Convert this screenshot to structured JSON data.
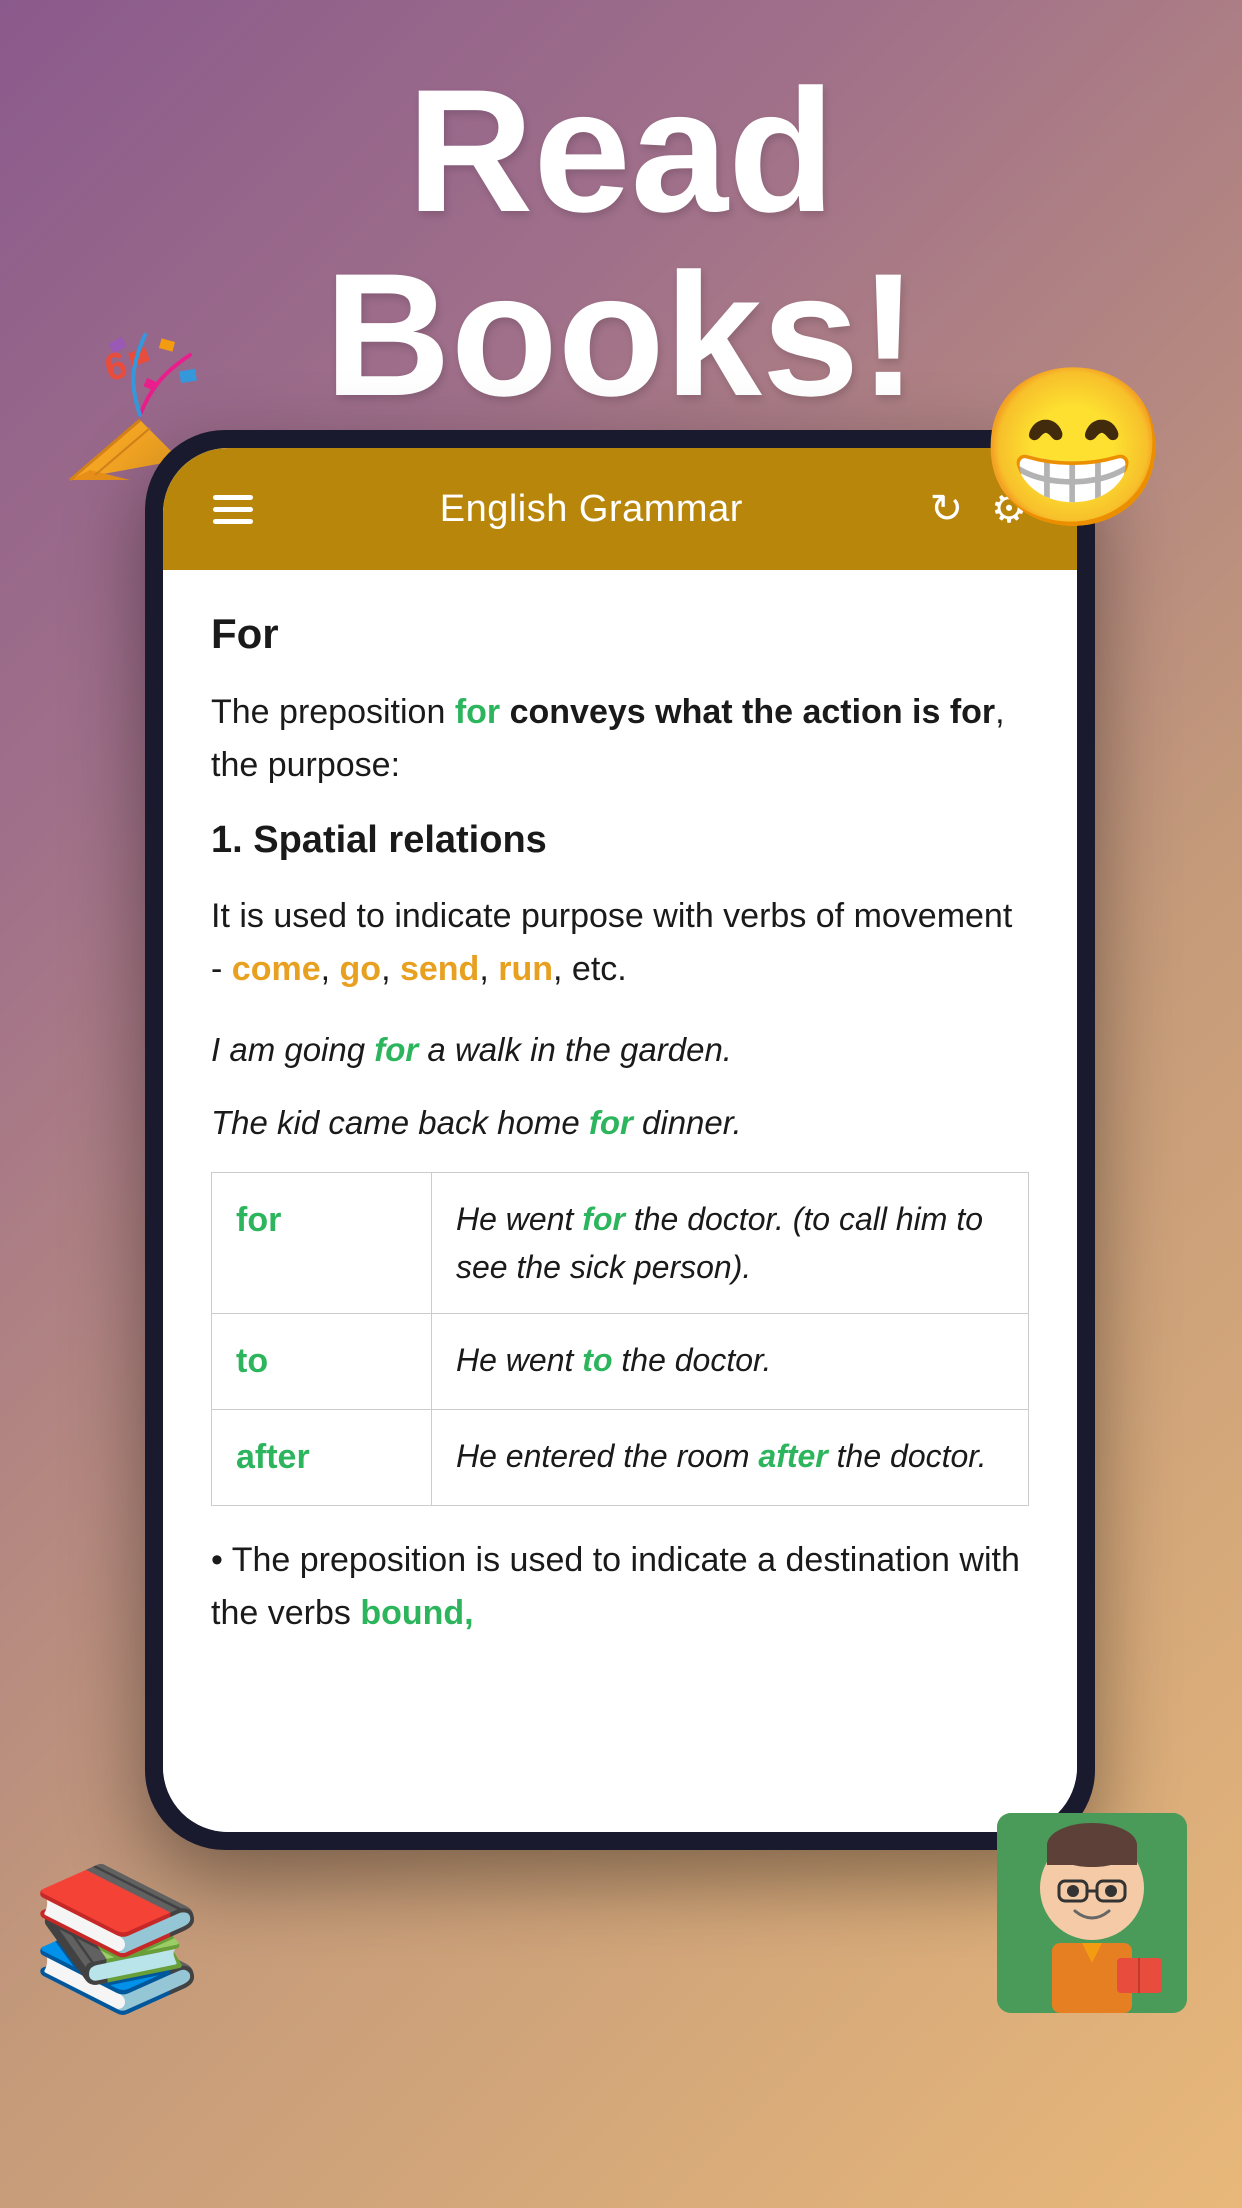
{
  "headline": {
    "line1": "Read",
    "line2": "Books!"
  },
  "decorations": {
    "confetti": "🎉",
    "emoji": "😁",
    "books": "📚",
    "student": "👨‍🏫"
  },
  "app": {
    "header": {
      "title": "English Grammar",
      "menu_label": "menu",
      "refresh_label": "refresh",
      "settings_label": "settings"
    },
    "content": {
      "main_heading": "For",
      "paragraph1_pre": "The preposition ",
      "paragraph1_keyword": "for",
      "paragraph1_post": " conveys what the action is for, the purpose:",
      "section1_heading": "1. Spatial relations",
      "section1_para": "It is used to indicate purpose with verbs of movement -",
      "movement_verbs": [
        "come",
        "go",
        "send",
        "run"
      ],
      "movement_verbs_suffix": ", etc.",
      "example1": "I am going ",
      "example1_keyword": "for",
      "example1_post": " a walk in the garden.",
      "example2": "The kid came back home ",
      "example2_keyword": "for",
      "example2_post": " dinner.",
      "table": {
        "rows": [
          {
            "keyword": "for",
            "example_pre": "He went ",
            "example_keyword": "for",
            "example_mid": " the doctor. (to call him to see the sick person)."
          },
          {
            "keyword": "to",
            "example_pre": "He went ",
            "example_keyword": "to",
            "example_mid": " the doctor."
          },
          {
            "keyword": "after",
            "example_pre": "He entered the room ",
            "example_keyword": "after",
            "example_mid": " the doctor."
          }
        ]
      },
      "bottom_bullet": "The preposition is used to indicate a destination with the verbs ",
      "bottom_keyword": "bound,",
      "bottom_suffix": ""
    }
  }
}
